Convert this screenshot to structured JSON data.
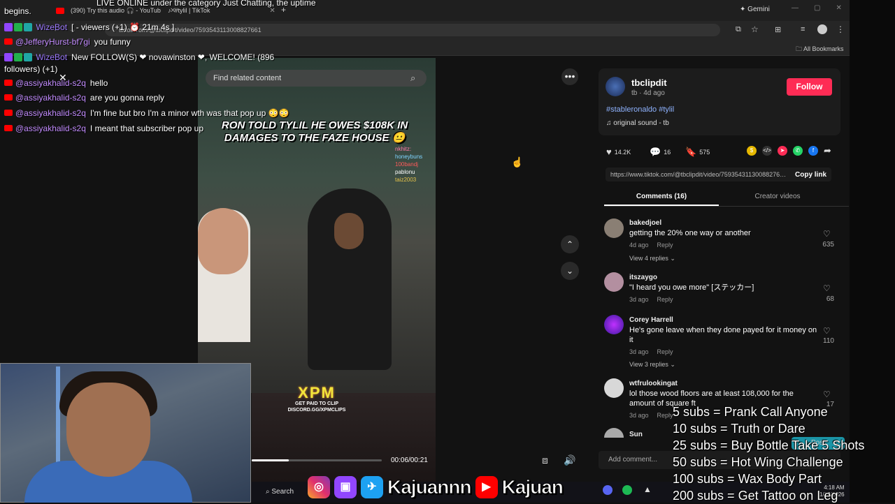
{
  "browser": {
    "tabs": [
      {
        "label": "(390) Try this audio 🎧 - YouTub"
      },
      {
        "label": "#tylil | TikTok"
      }
    ],
    "gemini_label": "Gemini",
    "url": "tiktok.com/@tbclipdit/video/7593543113008827661",
    "bookmarks_label": "All Bookmarks"
  },
  "chat": {
    "lines": [
      {
        "user": "",
        "text": "begins.",
        "type": "plain"
      },
      {
        "user": "WizeBot",
        "text": "[ - viewers (+1) ⏰ 21m 4s ]",
        "type": "bot"
      },
      {
        "user": "@JefferyHurst-bf7gi",
        "text": "you funny",
        "type": "yt"
      },
      {
        "user": "WizeBot",
        "text": "New FOLLOW(S) ❤ novawinston ❤, WELCOME! (896",
        "type": "bot"
      },
      {
        "user": "",
        "text": "followers) (+1)",
        "type": "plain"
      },
      {
        "user": "@assiyakhalid-s2q",
        "text": "hello",
        "type": "yt"
      },
      {
        "user": "@assiyakhalid-s2q",
        "text": "are you gonna reply",
        "type": "yt"
      },
      {
        "user": "@assiyakhalid-s2q",
        "text": "I'm fine but bro I'm a minor wth was that pop up 😳😳",
        "type": "yt"
      },
      {
        "user": "@assiyakhalid-s2q",
        "text": "I meant that subscriber pop up",
        "type": "yt"
      }
    ],
    "header_fragment": "LIVE ONLINE under the category Just Chatting, the uptime"
  },
  "video": {
    "search_placeholder": "Find related content",
    "caption": "RON TOLD TYLIL HE OWES $108K IN DAMAGES TO THE FAZE HOUSE 😐",
    "watermark": "XPM",
    "watermark_sub": "GET PAID TO CLIP\nDISCORD.GG/XPMCLIPS",
    "mini_chat": [
      "nkhitz:",
      "honeybuns",
      "100bandj",
      "pablonu",
      "taiz2003"
    ],
    "time": "00:06/00:21",
    "progress": 0.286
  },
  "post": {
    "author": "tbclipdit",
    "meta": "tb · 4d ago",
    "follow_label": "Follow",
    "hashtags": "#stableronaldo #tylil",
    "sound": "♫  original sound - tb",
    "likes": "14.2K",
    "comments_count": "16",
    "saves": "575",
    "link": "https://www.tiktok.com/@tbclipdit/video/7593543113008827661",
    "copy_label": "Copy link",
    "tab_comments": "Comments (16)",
    "tab_creator": "Creator videos",
    "add_comment_placeholder": "Add comment...",
    "post_label": "Post"
  },
  "comments": [
    {
      "user": "bakedjoel",
      "text": "getting the 20% one way or another",
      "date": "4d ago",
      "reply": "Reply",
      "likes": "635",
      "view": "View 4 replies ⌄"
    },
    {
      "user": "itszaygo",
      "text": "\"I heard you owe more\" [ステッカー]",
      "date": "3d ago",
      "reply": "Reply",
      "likes": "68",
      "view": ""
    },
    {
      "user": "Corey Harrell",
      "text": "He's gone leave when they done payed for it money on it",
      "date": "3d ago",
      "reply": "Reply",
      "likes": "110",
      "view": "View 3 replies ⌄"
    },
    {
      "user": "wtfrulookingat",
      "text": "lol those wood floors are at least 108,000 for the amount of square ft",
      "date": "3d ago",
      "reply": "Reply",
      "likes": "17",
      "view": ""
    },
    {
      "user": "Sun",
      "text": "",
      "date": "",
      "reply": "",
      "likes": "",
      "view": ""
    }
  ],
  "socials": {
    "name1": "Kajuannn",
    "name2": "Kajuan"
  },
  "taskbar": {
    "search": "Search",
    "time": "4:18 AM",
    "date": "1/12/2026"
  },
  "goals": [
    "5 subs =  Prank Call Anyone",
    "10 subs = Truth or Dare",
    "25 subs = Buy Bottle Take 5 Shots",
    "50 subs = Hot Wing Challenge",
    "100 subs = Wax Body Part",
    "200 subs = Get Tattoo on Leg"
  ],
  "colors": {
    "follow": "#fe2c55",
    "hashtag": "#8fb3ff",
    "chat_user": "#c38cff",
    "youtube": "#ff0000"
  }
}
